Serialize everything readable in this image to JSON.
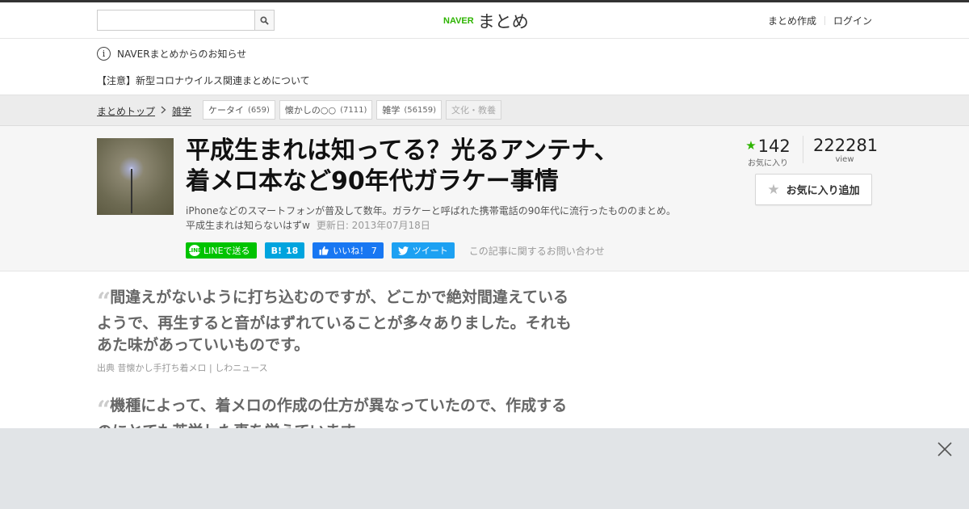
{
  "header": {
    "search_placeholder": "",
    "logo_naver": "NAVER",
    "logo_matome": "まとめ",
    "create_link": "まとめ作成",
    "login_link": "ログイン"
  },
  "notice": {
    "title": "NAVERまとめからのお知らせ",
    "item": "【注意】新型コロナウイルス関連まとめについて"
  },
  "breadcrumb": {
    "items": [
      "まとめトップ",
      "雑学"
    ],
    "tags": [
      {
        "label": "ケータイ",
        "count": "(659)"
      },
      {
        "label": "懐かしの○○",
        "count": "(7111)"
      },
      {
        "label": "雑学",
        "count": "(56159)"
      },
      {
        "label": "文化・教養",
        "count": ""
      }
    ]
  },
  "article": {
    "title_line1": "平成生まれは知ってる？光るアンテナ、",
    "title_line2": "着メロ本など90年代ガラケー事情",
    "desc_line1": "iPhoneなどのスマートフォンが普及して数年。ガラケーと呼ばれた携帯電話の90年代に流行ったもののまとめ。",
    "desc_line2": "平成生まれは知らないはずw",
    "updated": "更新日: 2013年07月18日",
    "favorites": "142",
    "favorites_label": "お気に入り",
    "views": "222281",
    "views_label": "view",
    "fav_button": "お気に入り追加"
  },
  "share": {
    "line": "LINEで送る",
    "hatena_count": "18",
    "fb_label": "いいね！ 7",
    "tweet": "ツイート",
    "contact": "この記事に関するお問い合わせ"
  },
  "quotes": [
    {
      "lines": [
        "間違えがないように打ち込むのですが、どこかで絶対間違えている",
        "ようで、再生すると音がはずれていることが多々ありました。それも",
        "あた味があっていいものです。"
      ],
      "source_label": "出典",
      "source": "昔懐かし手打ち着メロ | しわニュース"
    },
    {
      "lines": [
        "機種によって、着メロの作成の仕方が異なっていたので、作成する",
        "のにとても苦労した事を覚えています。"
      ]
    }
  ],
  "colors": {
    "brand_green": "#2db400",
    "line_green": "#00c300",
    "hatena_blue": "#00a4de",
    "facebook_blue": "#1877f2",
    "twitter_blue": "#1da1f2"
  }
}
